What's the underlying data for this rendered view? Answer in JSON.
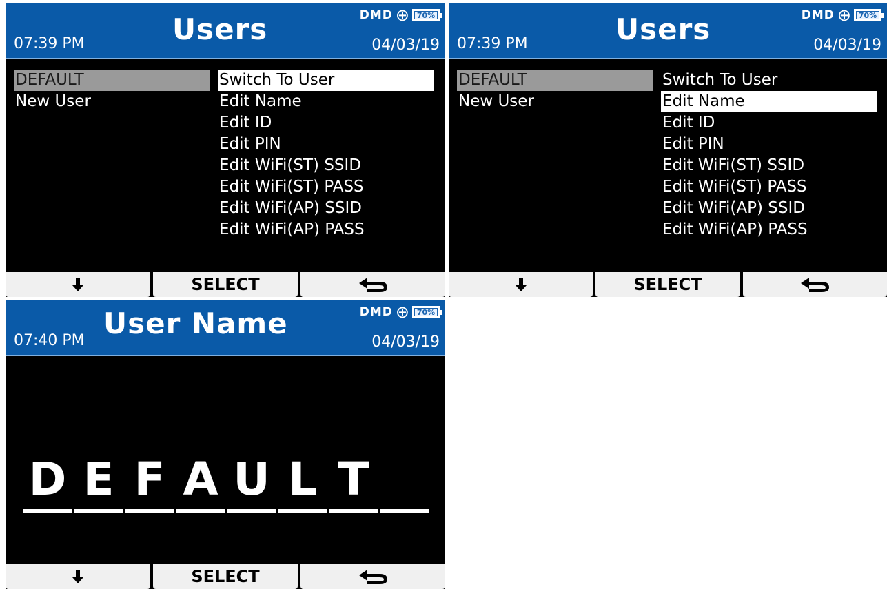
{
  "screens": [
    {
      "header": {
        "time": "07:39 PM",
        "title": "Users",
        "date": "04/03/19",
        "status_text": "DMD",
        "battery": "70%"
      },
      "users": [
        "DEFAULT",
        "New User"
      ],
      "menu": [
        "Switch To User",
        "Edit Name",
        "Edit ID",
        "Edit PIN",
        "Edit WiFi(ST) SSID",
        "Edit WiFi(ST) PASS",
        "Edit WiFi(AP) SSID",
        "Edit WiFi(AP) PASS"
      ],
      "selected_menu_index": 0,
      "softkeys": {
        "select_label": "SELECT"
      }
    },
    {
      "header": {
        "time": "07:39 PM",
        "title": "Users",
        "date": "04/03/19",
        "status_text": "DMD",
        "battery": "70%"
      },
      "users": [
        "DEFAULT",
        "New User"
      ],
      "menu": [
        "Switch To User",
        "Edit Name",
        "Edit ID",
        "Edit PIN",
        "Edit WiFi(ST) SSID",
        "Edit WiFi(ST) PASS",
        "Edit WiFi(AP) SSID",
        "Edit WiFi(AP) PASS"
      ],
      "selected_menu_index": 1,
      "softkeys": {
        "select_label": "SELECT"
      }
    },
    {
      "header": {
        "time": "07:40 PM",
        "title": "User Name",
        "date": "04/03/19",
        "status_text": "DMD",
        "battery": "70%"
      },
      "name_chars": [
        "D",
        "E",
        "F",
        "A",
        "U",
        "L",
        "T",
        ""
      ],
      "softkeys": {
        "select_label": "SELECT"
      }
    }
  ],
  "icons": {
    "down": "arrow-down-icon",
    "back": "back-arrow-icon",
    "globe": "globe-icon",
    "battery": "battery-icon"
  },
  "colors": {
    "header_bg": "#0a5aa8",
    "screen_bg": "#000000",
    "selected_gray": "#9a9a9a",
    "softkey_bg": "#f0f0f0"
  }
}
